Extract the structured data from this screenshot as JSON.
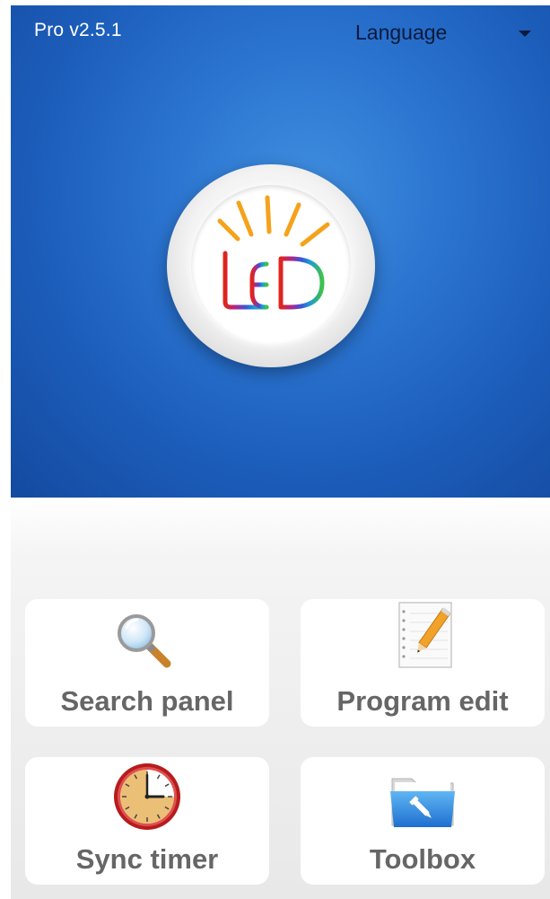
{
  "header": {
    "version": "Pro v2.5.1",
    "language_label": "Language",
    "background_color": "#2a73cf"
  },
  "logo": {
    "text": "LED",
    "ray_color": "#f5a21b"
  },
  "menu": {
    "search_panel": {
      "label": "Search panel",
      "icon": "magnifier-icon"
    },
    "program_edit": {
      "label": "Program edit",
      "icon": "notepad-pencil-icon"
    },
    "sync_timer": {
      "label": "Sync timer",
      "icon": "clock-icon"
    },
    "toolbox": {
      "label": "Toolbox",
      "icon": "folder-tool-icon"
    }
  },
  "colors": {
    "card_label": "#666666",
    "card_background": "#ffffff",
    "panel_background": "#eeeeee"
  }
}
